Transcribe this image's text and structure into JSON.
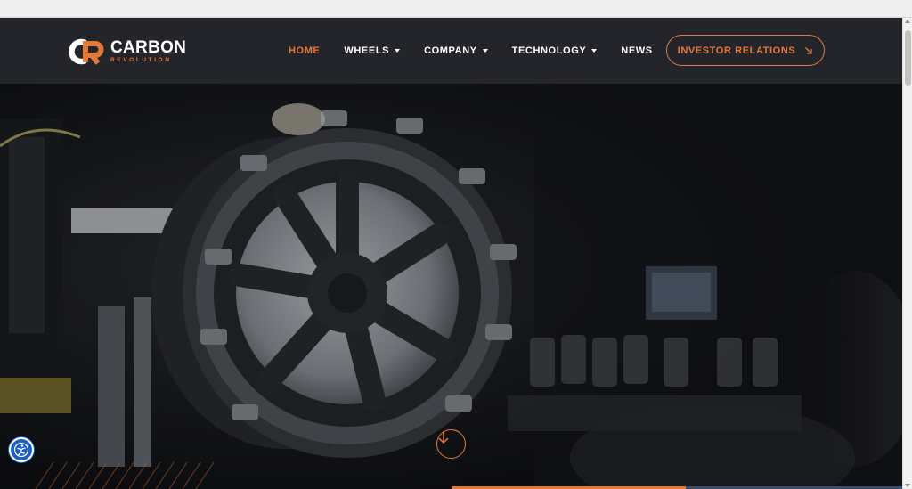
{
  "brand": {
    "name": "CARBON",
    "tagline": "REVOLUTION",
    "accent_color": "#e2783a",
    "header_bg": "#24252a"
  },
  "nav": {
    "items": [
      {
        "label": "HOME",
        "active": true,
        "dropdown": false
      },
      {
        "label": "WHEELS",
        "active": false,
        "dropdown": true
      },
      {
        "label": "COMPANY",
        "active": false,
        "dropdown": true
      },
      {
        "label": "TECHNOLOGY",
        "active": false,
        "dropdown": true
      },
      {
        "label": "NEWS",
        "active": false,
        "dropdown": false
      }
    ],
    "cta": {
      "label": "INVESTOR RELATIONS",
      "icon": "arrow-down-right-icon"
    }
  },
  "hero": {
    "scroll_icon": "arrow-down-circle-icon"
  },
  "accessibility": {
    "icon": "accessibility-icon",
    "color": "#1b5fc1"
  }
}
